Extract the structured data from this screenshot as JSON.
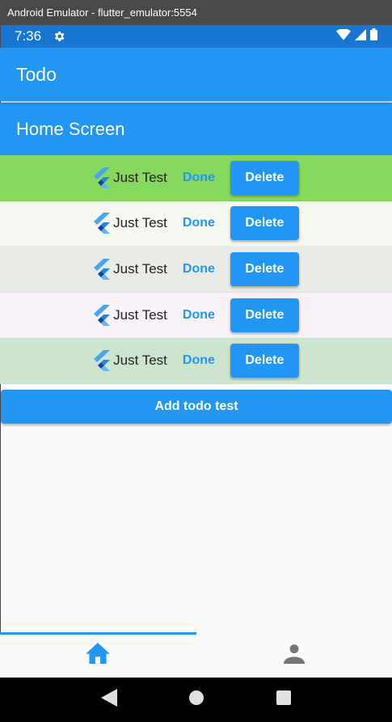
{
  "window": {
    "title": "Android Emulator - flutter_emulator:5554"
  },
  "status_bar": {
    "time": "7:36"
  },
  "app_bar": {
    "title": "Todo"
  },
  "screen": {
    "heading": "Home Screen"
  },
  "todos": [
    {
      "text": "Just Test",
      "done_label": "Done",
      "delete_label": "Delete",
      "color": "#86d95d"
    },
    {
      "text": "Just Test",
      "done_label": "Done",
      "delete_label": "Delete",
      "color": "#f5f7f1"
    },
    {
      "text": "Just Test",
      "done_label": "Done",
      "delete_label": "Delete",
      "color": "#e9ebe6"
    },
    {
      "text": "Just Test",
      "done_label": "Done",
      "delete_label": "Delete",
      "color": "#f8f2f9"
    },
    {
      "text": "Just Test",
      "done_label": "Done",
      "delete_label": "Delete",
      "color": "#cde5cf"
    }
  ],
  "add_button": {
    "label": "Add todo test"
  },
  "bottom_nav": {
    "tabs": [
      {
        "icon": "home-icon",
        "active": true
      },
      {
        "icon": "person-icon",
        "active": false
      }
    ]
  },
  "colors": {
    "primary": "#2196f3",
    "status_bar": "#1976d2",
    "active_tab": "#2196f3",
    "inactive_tab": "#757575"
  }
}
